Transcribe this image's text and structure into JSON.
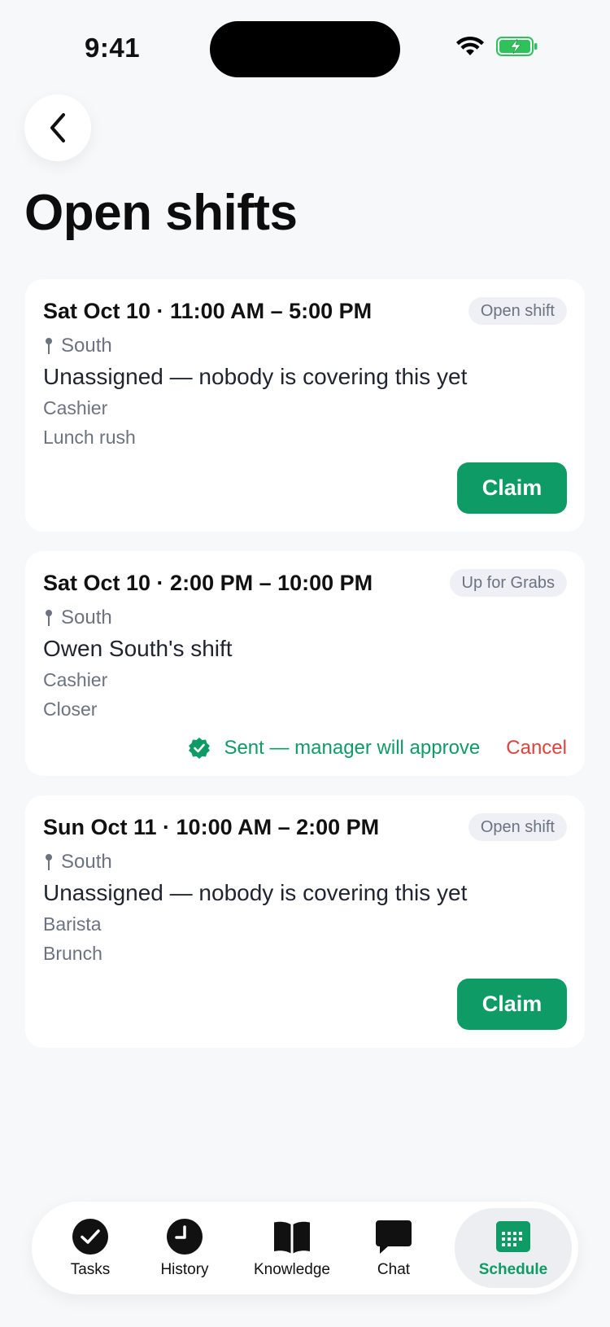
{
  "status_bar": {
    "time": "9:41"
  },
  "header": {
    "title": "Open shifts"
  },
  "shifts": [
    {
      "when": "Sat Oct 10 · 11:00 AM – 5:00 PM",
      "badge": "Open shift",
      "location": "South",
      "headline": "Unassigned — nobody is covering this yet",
      "role": "Cashier",
      "note": "Lunch rush",
      "action": "Claim"
    },
    {
      "when": "Sat Oct 10 · 2:00 PM – 10:00 PM",
      "badge": "Up for Grabs",
      "location": "South",
      "headline": "Owen South's shift",
      "role": "Cashier",
      "note": "Closer",
      "status": "Sent — manager will approve",
      "cancel": "Cancel"
    },
    {
      "when": "Sun Oct 11 · 10:00 AM – 2:00 PM",
      "badge": "Open shift",
      "location": "South",
      "headline": "Unassigned — nobody is covering this yet",
      "role": "Barista",
      "note": "Brunch",
      "action": "Claim"
    }
  ],
  "tabbar": {
    "tasks": "Tasks",
    "history": "History",
    "knowledge": "Knowledge",
    "chat": "Chat",
    "schedule": "Schedule",
    "active": "Schedule"
  },
  "colors": {
    "accent": "#0f9b66",
    "danger": "#e0413c",
    "muted": "#6b7280",
    "background": "#f7f8fa"
  }
}
